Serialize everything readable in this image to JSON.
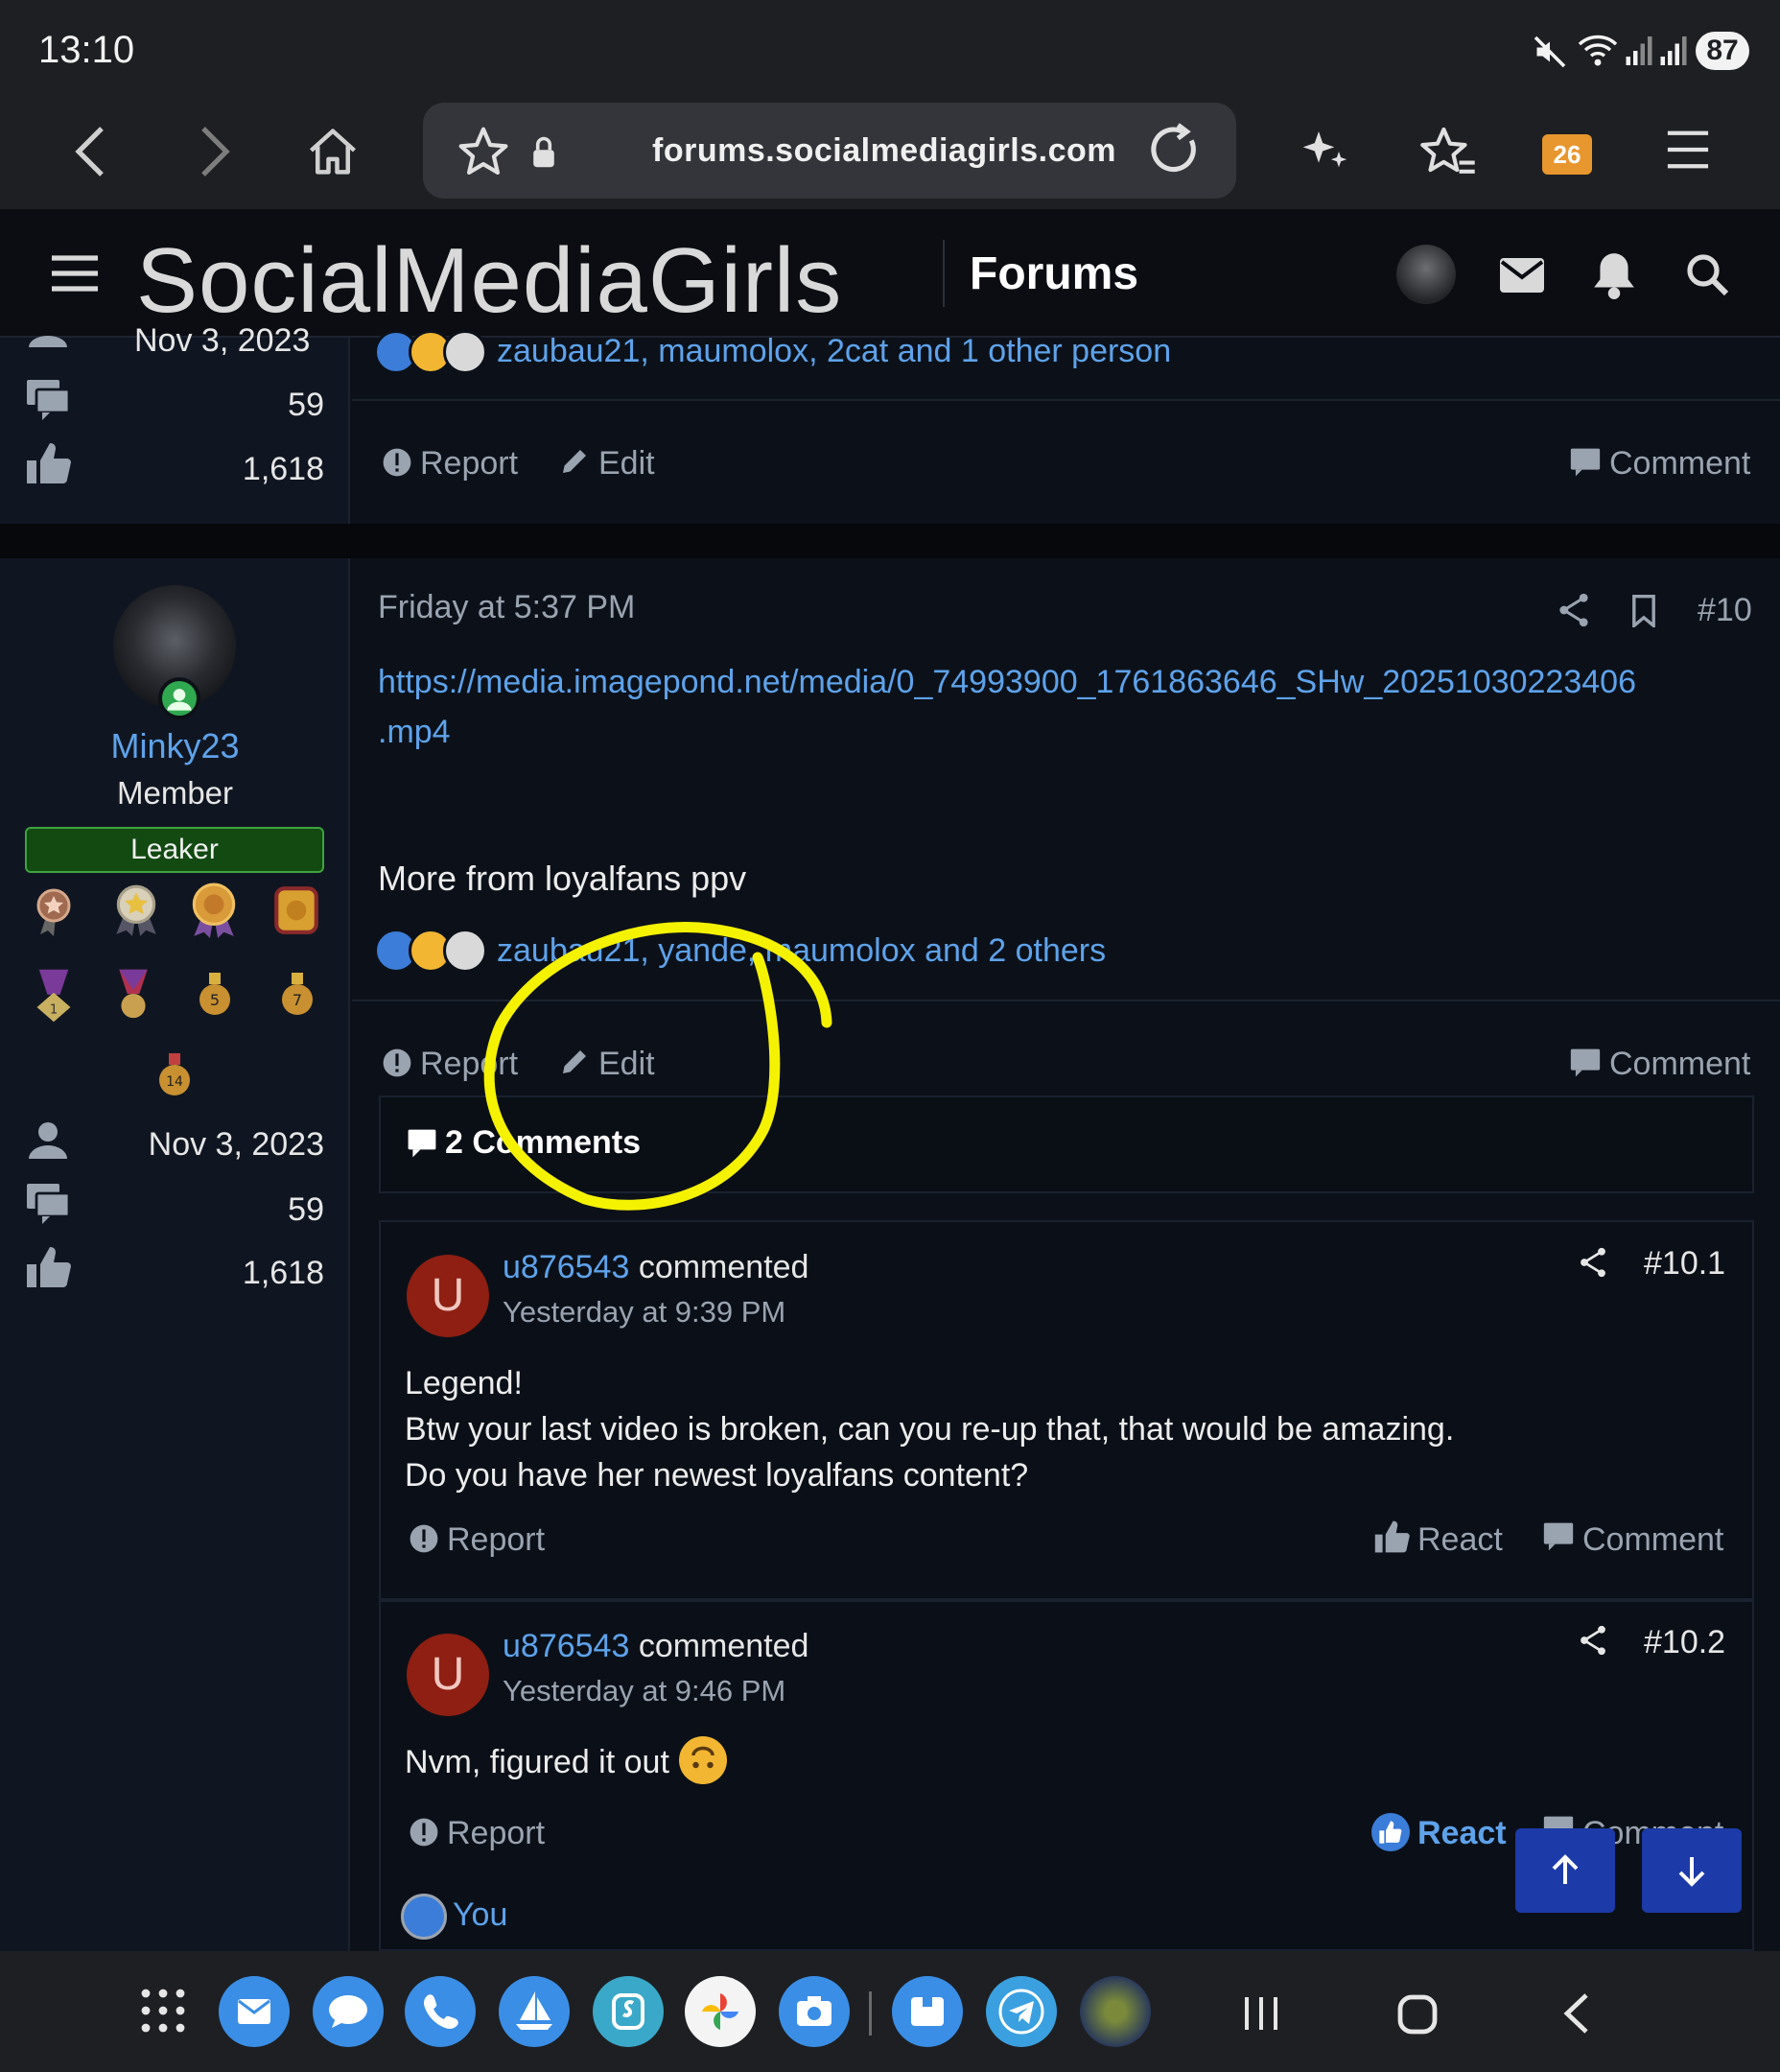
{
  "status_bar": {
    "time": "13:10",
    "battery": "87"
  },
  "browser": {
    "url": "forums.socialmediagirls.com",
    "tab_count": "26"
  },
  "site_header": {
    "logo": "SocialMediaGirls",
    "section": "Forums"
  },
  "prev_post": {
    "join_date_partial": "Nov 3, 2023",
    "messages": "59",
    "reactions": "1,618",
    "reaction_users": "zaubau21, maumolox, 2cat and 1 other person",
    "actions": {
      "report": "Report",
      "edit": "Edit",
      "comment": "Comment"
    }
  },
  "post": {
    "author": {
      "username": "Minky23",
      "title": "Member",
      "badge": "Leaker",
      "trophy_labels": [
        "5",
        "7",
        "14"
      ],
      "join_date": "Nov 3, 2023",
      "messages": "59",
      "reactions": "1,618"
    },
    "time": "Friday at 5:37 PM",
    "number": "#10",
    "link_line1": "https://media.imagepond.net/media/0_74993900_1761863646_SHw_20251030223406",
    "link_line2": ".mp4",
    "body": "More from loyalfans ppv",
    "reaction_users": "zaubau21, yande, maumolox and 2 others",
    "actions": {
      "report": "Report",
      "edit": "Edit",
      "comment": "Comment"
    },
    "comments_header": "2 Comments"
  },
  "comments": [
    {
      "avatar_letter": "U",
      "username": "u876543",
      "verb": "commented",
      "time": "Yesterday at 9:39 PM",
      "number": "#10.1",
      "lines": [
        "Legend!",
        "Btw your last video is broken, can you re-up that, that would be amazing.",
        "Do you have her newest loyalfans content?"
      ],
      "actions": {
        "report": "Report",
        "react": "React",
        "comment": "Comment"
      }
    },
    {
      "avatar_letter": "U",
      "username": "u876543",
      "verb": "commented",
      "time": "Yesterday at 9:46 PM",
      "number": "#10.2",
      "lines": [
        "Nvm, figured it out"
      ],
      "actions": {
        "report": "Report",
        "react": "React",
        "comment": "Comment"
      },
      "reacted_by": "You"
    }
  ],
  "colors": {
    "accent_link": "#5ea2ea",
    "background": "#0c1119",
    "sidebar": "#101621",
    "leaker_badge": "#124a12",
    "annotation": "#f5f200",
    "fab": "#1c3aa8"
  },
  "icons": [
    "mute-icon",
    "wifi-icon",
    "signal-icon",
    "back-icon",
    "forward-icon",
    "home-icon",
    "star-icon",
    "lock-icon",
    "reload-icon",
    "sparkle-icon",
    "bookmarks-icon",
    "tabs-icon",
    "menu-icon",
    "mail-icon",
    "bell-icon",
    "search-icon",
    "share-icon",
    "bookmark-icon",
    "report-icon",
    "edit-icon",
    "comment-icon",
    "like-icon",
    "user-icon",
    "arrow-up-icon",
    "arrow-down-icon"
  ]
}
